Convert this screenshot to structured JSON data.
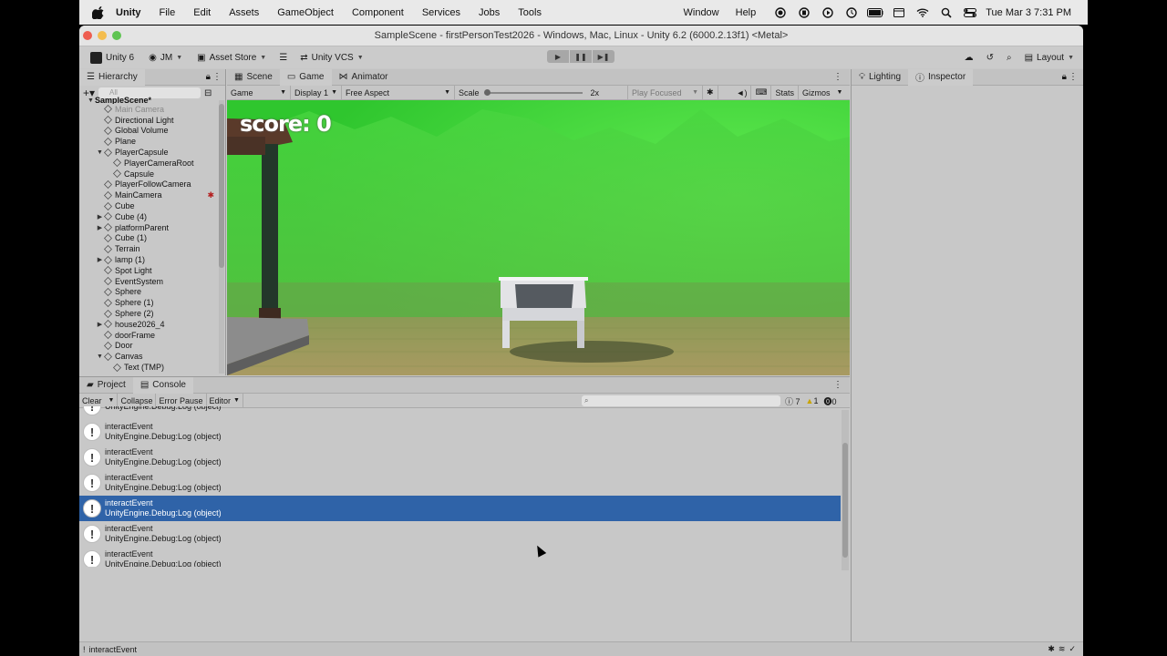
{
  "menubar": {
    "app": "Unity",
    "items": [
      "File",
      "Edit",
      "Assets",
      "GameObject",
      "Component",
      "Services",
      "Jobs",
      "Tools"
    ],
    "right_items": [
      "Window",
      "Help"
    ],
    "clock": "Tue Mar 3  7:31 PM"
  },
  "window": {
    "title": "SampleScene - firstPersonTest2026 - Windows, Mac, Linux - Unity 6.2 (6000.2.13f1) <Metal>"
  },
  "toolbar": {
    "unity_version": "Unity 6",
    "account": "JM",
    "asset_store": "Asset Store",
    "vcs": "Unity VCS",
    "layout": "Layout"
  },
  "hierarchy": {
    "tab": "Hierarchy",
    "search_placeholder": "All",
    "scene": "SampleScene*",
    "items": [
      {
        "label": "Main Camera",
        "depth": 1,
        "arrow": "",
        "dim": true
      },
      {
        "label": "Directional Light",
        "depth": 1,
        "arrow": ""
      },
      {
        "label": "Global Volume",
        "depth": 1,
        "arrow": ""
      },
      {
        "label": "Plane",
        "depth": 1,
        "arrow": ""
      },
      {
        "label": "PlayerCapsule",
        "depth": 1,
        "arrow": "▼"
      },
      {
        "label": "PlayerCameraRoot",
        "depth": 2,
        "arrow": ""
      },
      {
        "label": "Capsule",
        "depth": 2,
        "arrow": ""
      },
      {
        "label": "PlayerFollowCamera",
        "depth": 1,
        "arrow": ""
      },
      {
        "label": "MainCamera",
        "depth": 1,
        "arrow": ""
      },
      {
        "label": "Cube",
        "depth": 1,
        "arrow": ""
      },
      {
        "label": "Cube (4)",
        "depth": 1,
        "arrow": "▶"
      },
      {
        "label": "platformParent",
        "depth": 1,
        "arrow": "▶"
      },
      {
        "label": "Cube (1)",
        "depth": 1,
        "arrow": ""
      },
      {
        "label": "Terrain",
        "depth": 1,
        "arrow": ""
      },
      {
        "label": "lamp (1)",
        "depth": 1,
        "arrow": "▶"
      },
      {
        "label": "Spot Light",
        "depth": 1,
        "arrow": ""
      },
      {
        "label": "EventSystem",
        "depth": 1,
        "arrow": ""
      },
      {
        "label": "Sphere",
        "depth": 1,
        "arrow": ""
      },
      {
        "label": "Sphere (1)",
        "depth": 1,
        "arrow": ""
      },
      {
        "label": "Sphere (2)",
        "depth": 1,
        "arrow": ""
      },
      {
        "label": "house2026_4",
        "depth": 1,
        "arrow": "▶"
      },
      {
        "label": "doorFrame",
        "depth": 1,
        "arrow": ""
      },
      {
        "label": "Door",
        "depth": 1,
        "arrow": ""
      },
      {
        "label": "Canvas",
        "depth": 1,
        "arrow": "▼"
      },
      {
        "label": "Text (TMP)",
        "depth": 2,
        "arrow": ""
      }
    ]
  },
  "center_tabs": {
    "scene": "Scene",
    "game": "Game",
    "animator": "Animator"
  },
  "game_controls": {
    "mode": "Game",
    "display": "Display 1",
    "aspect": "Free Aspect",
    "scale_label": "Scale",
    "scale_value": "2x",
    "play_focused": "Play Focused",
    "stats": "Stats",
    "gizmos": "Gizmos"
  },
  "game": {
    "score_text": "score: 0"
  },
  "right_tabs": {
    "lighting": "Lighting",
    "inspector": "Inspector"
  },
  "bottom_tabs": {
    "project": "Project",
    "console": "Console"
  },
  "console_toolbar": {
    "clear": "Clear",
    "collapse": "Collapse",
    "error_pause": "Error Pause",
    "editor": "Editor",
    "log_count": "7",
    "warn_count": "1",
    "error_count": "0"
  },
  "console_logs": [
    {
      "line1": "",
      "line2": "UnityEngine.Debug:Log (object)",
      "selected": false
    },
    {
      "line1": "interactEvent",
      "line2": "UnityEngine.Debug:Log (object)",
      "selected": false
    },
    {
      "line1": "interactEvent",
      "line2": "UnityEngine.Debug:Log (object)",
      "selected": false
    },
    {
      "line1": "interactEvent",
      "line2": "UnityEngine.Debug:Log (object)",
      "selected": false
    },
    {
      "line1": "interactEvent",
      "line2": "UnityEngine.Debug:Log (object)",
      "selected": true
    },
    {
      "line1": "interactEvent",
      "line2": "UnityEngine.Debug:Log (object)",
      "selected": false
    },
    {
      "line1": "interactEvent",
      "line2": "UnityEngine.Debug:Log (object)",
      "selected": false
    }
  ],
  "statusbar": {
    "message": "interactEvent"
  },
  "colors": {
    "selection": "#2f63a8",
    "sky_green": "#3ed43a",
    "panel_bg": "#c8c8c8"
  }
}
